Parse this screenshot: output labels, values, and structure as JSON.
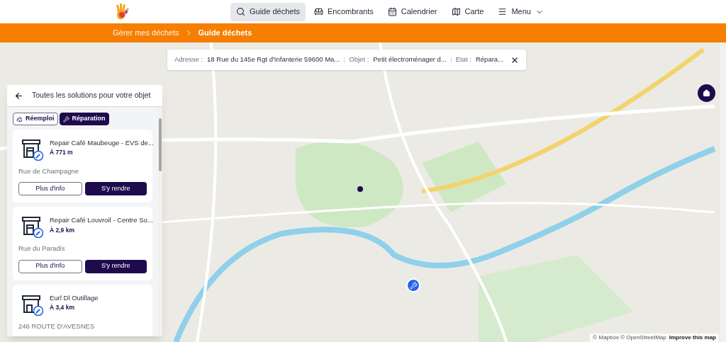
{
  "nav": {
    "items": [
      {
        "label": "Guide déchets",
        "kind": "search",
        "selected": true
      },
      {
        "label": "Encombrants",
        "kind": "sofa",
        "selected": false
      },
      {
        "label": "Calendrier",
        "kind": "calendar",
        "selected": false
      },
      {
        "label": "Carte",
        "kind": "map",
        "selected": false
      },
      {
        "label": "Menu",
        "kind": "menu",
        "selected": false
      }
    ]
  },
  "breadcrumb": [
    {
      "label": "Gérer mes déchets",
      "current": false
    },
    {
      "label": "Guide déchets",
      "current": true
    }
  ],
  "filters": [
    {
      "label": "Adresse :",
      "value": "18 Rue du 145e Rgt d'Infanterie 59600 Ma..."
    },
    {
      "label": "Objet :",
      "value": "Petit électroménager d..."
    },
    {
      "label": "Etat :",
      "value": "Répara..."
    }
  ],
  "panel": {
    "title": "Toutes les solutions pour votre objet",
    "tabs": [
      {
        "label": "Réemploi",
        "kind": "reuse",
        "selected": false
      },
      {
        "label": "Réparation",
        "kind": "repair",
        "selected": true
      }
    ],
    "results": [
      {
        "name": "Repair Café Maubeuge - EVS de...",
        "distance": "À 771 m",
        "address": "Rue de Champagne",
        "kind": "building",
        "buttons": [
          "Plus d'info",
          "S'y rendre"
        ]
      },
      {
        "name": "Repair Café Louvroil - Centre So...",
        "distance": "À 2,9 km",
        "address": "Rue du Paradis",
        "kind": "building",
        "buttons": [
          "Plus d'info",
          "S'y rendre"
        ]
      },
      {
        "name": "Eurl Dl Outillage",
        "distance": "À 3,4 km",
        "address": "246 ROUTE D'AVESNES",
        "kind": "shop"
      }
    ]
  },
  "attribution": {
    "text": "© Mapbox © OpenStreetMap",
    "link": "Improve this map"
  }
}
